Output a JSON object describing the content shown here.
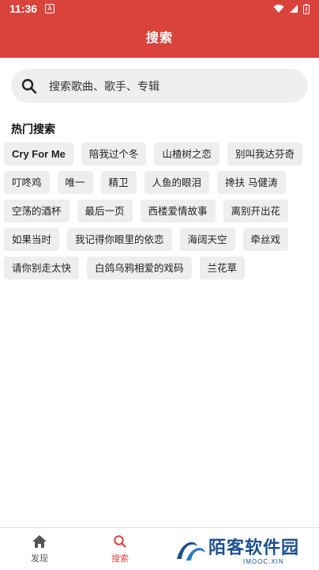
{
  "status_bar": {
    "time": "11:36",
    "app_badge": "A"
  },
  "header": {
    "title": "搜索"
  },
  "search": {
    "placeholder": "搜索歌曲、歌手、专辑"
  },
  "hot": {
    "title": "热门搜索",
    "rows": [
      [
        "Cry For Me",
        "陪我过个冬",
        "山楂树之恋",
        "别叫我达芬奇"
      ],
      [
        "叮咚鸡",
        "唯一",
        "精卫",
        "人鱼的眼泪",
        "搀扶 马健涛"
      ],
      [
        "空荡的酒杯",
        "最后一页",
        "西楼爱情故事",
        "离别开出花"
      ],
      [
        "如果当时",
        "我记得你眼里的依恋",
        "海阔天空",
        "牵丝戏"
      ],
      [
        "请你别走太快",
        "白鸽乌鸦相爱的戏码",
        "兰花草"
      ]
    ]
  },
  "nav": {
    "discover": "发现",
    "search": "搜索"
  },
  "watermark": {
    "text": "陌客软件园",
    "sub": "IMOOC.XIN"
  },
  "colors": {
    "accent": "#d9433c",
    "tag_bg": "#eeeeee",
    "search_bg": "#efefef"
  },
  "icons": [
    "search-icon",
    "home-icon",
    "wifi-icon",
    "signal-icon",
    "battery-icon"
  ]
}
